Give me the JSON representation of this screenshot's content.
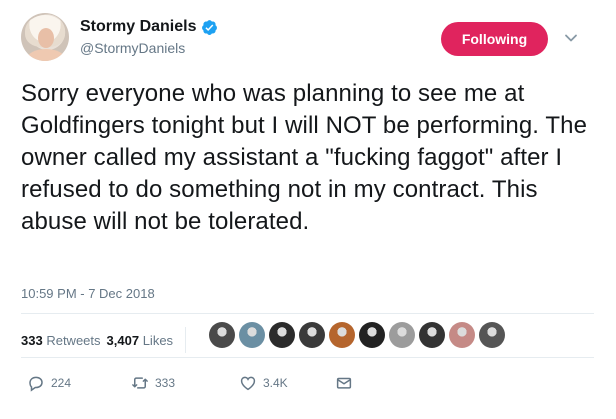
{
  "user": {
    "display_name": "Stormy Daniels",
    "handle": "@StormyDaniels",
    "verified_icon": "verified-badge-icon",
    "avatar_icon": "profile-photo"
  },
  "follow_button": {
    "label": "Following",
    "color": "#e0245e"
  },
  "menu_icon": "chevron-down-icon",
  "tweet": {
    "text": "Sorry everyone who was planning to see me at Goldfingers tonight but I will NOT be performing. The owner called my assistant a \"fucking faggot\" after I refused to do something not in my contract. This abuse will not be tolerated.",
    "timestamp": "10:59 PM - 7 Dec 2018"
  },
  "stats": {
    "retweets_count": "333",
    "retweets_label": "Retweets",
    "likes_count": "3,407",
    "likes_label": "Likes"
  },
  "likers": [
    {
      "name": "liker-1",
      "color": "#4a4a4a"
    },
    {
      "name": "liker-2",
      "color": "#6b8fa3"
    },
    {
      "name": "liker-3",
      "color": "#2b2b2b"
    },
    {
      "name": "liker-4",
      "color": "#3a3a3a"
    },
    {
      "name": "liker-5",
      "color": "#b5652d"
    },
    {
      "name": "liker-6",
      "color": "#222222"
    },
    {
      "name": "liker-7",
      "color": "#9c9c9c"
    },
    {
      "name": "liker-8",
      "color": "#333333"
    },
    {
      "name": "liker-9",
      "color": "#c58a86"
    },
    {
      "name": "liker-10",
      "color": "#555555"
    }
  ],
  "actions": {
    "reply_count": "224",
    "retweet_count": "333",
    "like_count": "3.4K"
  },
  "colors": {
    "text": "#14171a",
    "muted": "#657786",
    "accent": "#1da1f2"
  }
}
